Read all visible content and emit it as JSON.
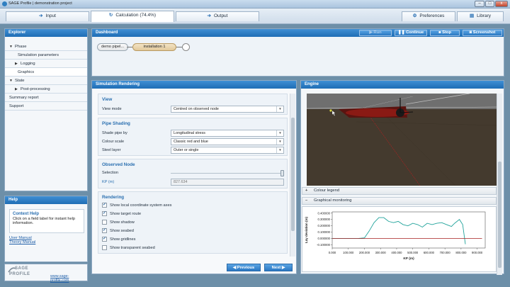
{
  "window": {
    "title": "SAGE Profile | demonstration project",
    "minimize": "–",
    "maximize": "□",
    "close": "x"
  },
  "tabs": [
    {
      "label": "Input",
      "icon": "➔"
    },
    {
      "label": "Calculation (74.4%)",
      "icon": "↻"
    },
    {
      "label": "Output",
      "icon": "➔"
    }
  ],
  "right_tabs": [
    {
      "label": "Preferences",
      "icon": "⚙"
    },
    {
      "label": "Library",
      "icon": "▤"
    }
  ],
  "explorer": {
    "title": "Explorer",
    "items": [
      {
        "label": "Phase",
        "caret": "▼"
      },
      {
        "label": "Simulation parameters"
      },
      {
        "label": "Logging",
        "caret": "▶"
      },
      {
        "label": "Graphics"
      },
      {
        "label": "State",
        "caret": "▼"
      },
      {
        "label": "Post-processing",
        "caret": "▶"
      },
      {
        "label": "Summary report"
      },
      {
        "label": "Support"
      }
    ]
  },
  "help": {
    "title": "Help",
    "box_title": "Context Help",
    "box_text": "Click on a field label for instant help information.",
    "links": [
      "User Manual",
      "Theory Manual"
    ]
  },
  "brand": {
    "logo_top": "SAGE",
    "logo_bottom": "PROFILE",
    "url": "www.sage-profile.com"
  },
  "dashboard": {
    "title": "Dashboard",
    "buttons": {
      "run": "Run",
      "continue": "Continue",
      "stop": "Stop",
      "screenshot": "Screenshot"
    },
    "nodes": [
      "demo pipel...",
      "installation 1"
    ]
  },
  "rendering": {
    "title": "Simulation Rendering",
    "view": {
      "title": "View",
      "mode_label": "View mode",
      "mode_value": "Centred on observed node"
    },
    "shading": {
      "title": "Pipe Shading",
      "shade_label": "Shade pipe by",
      "shade_value": "Longitudinal stress",
      "scale_label": "Colour scale",
      "scale_value": "Classic red and blue",
      "steel_label": "Steel layer",
      "steel_value": "Outer or single"
    },
    "observed": {
      "title": "Observed Node",
      "selection_label": "Selection",
      "kp_label": "KP (m)",
      "kp_value": "827.634",
      "selection_fraction": 1.0
    },
    "render": {
      "title": "Rendering",
      "options": [
        {
          "label": "Show local coordinate system axes",
          "checked": true
        },
        {
          "label": "Show target route",
          "checked": true
        },
        {
          "label": "Show shadow",
          "checked": false
        },
        {
          "label": "Show seabed",
          "checked": true
        },
        {
          "label": "Show gridlines",
          "checked": true
        },
        {
          "label": "Show transparent seabed",
          "checked": false
        }
      ]
    },
    "previous": "Previous",
    "next": "Next"
  },
  "engine": {
    "title": "Engine",
    "colour_legend": "Colour legend",
    "graphical_monitoring": "Graphical monitoring",
    "plus": "+",
    "minus": "–",
    "colors": {
      "sky": "#6f6f6f",
      "seabed": "#443a2e",
      "pipe": "#8a1a14"
    }
  },
  "chart_data": {
    "type": "line",
    "title": "",
    "xlabel": "KP (m)",
    "ylabel": "Lay deviation (m)",
    "xlim": [
      0,
      950000
    ],
    "ylim": [
      -0.15,
      0.42
    ],
    "x_ticks": [
      "0.000",
      "100.000",
      "200.000",
      "300.000",
      "400.000",
      "500.000",
      "600.000",
      "700.000",
      "800.000",
      "900.000"
    ],
    "x_tick_values": [
      0,
      100000,
      200000,
      300000,
      400000,
      500000,
      600000,
      700000,
      800000,
      900000
    ],
    "y_ticks": [
      "0.400000",
      "0.300000",
      "0.200000",
      "0.100000",
      "0.000000",
      "-0.100000"
    ],
    "y_tick_values": [
      0.4,
      0.3,
      0.2,
      0.1,
      0.0,
      -0.1
    ],
    "series": [
      {
        "color": "#21a39b",
        "x": [
          0,
          80000,
          160000,
          200000,
          230000,
          260000,
          290000,
          320000,
          350000,
          380000,
          410000,
          440000,
          470000,
          500000,
          530000,
          560000,
          590000,
          620000,
          650000,
          680000,
          710000,
          740000,
          760000,
          790000,
          810000,
          827000
        ],
        "y": [
          0.0,
          0.0,
          0.0,
          0.01,
          0.12,
          0.25,
          0.33,
          0.33,
          0.27,
          0.25,
          0.27,
          0.22,
          0.2,
          0.24,
          0.22,
          0.18,
          0.24,
          0.22,
          0.24,
          0.25,
          0.22,
          0.19,
          0.24,
          0.3,
          0.22,
          -0.09
        ]
      },
      {
        "color": "#a51e1e",
        "x": [
          0,
          930000
        ],
        "y": [
          0.0,
          0.0
        ]
      }
    ]
  }
}
